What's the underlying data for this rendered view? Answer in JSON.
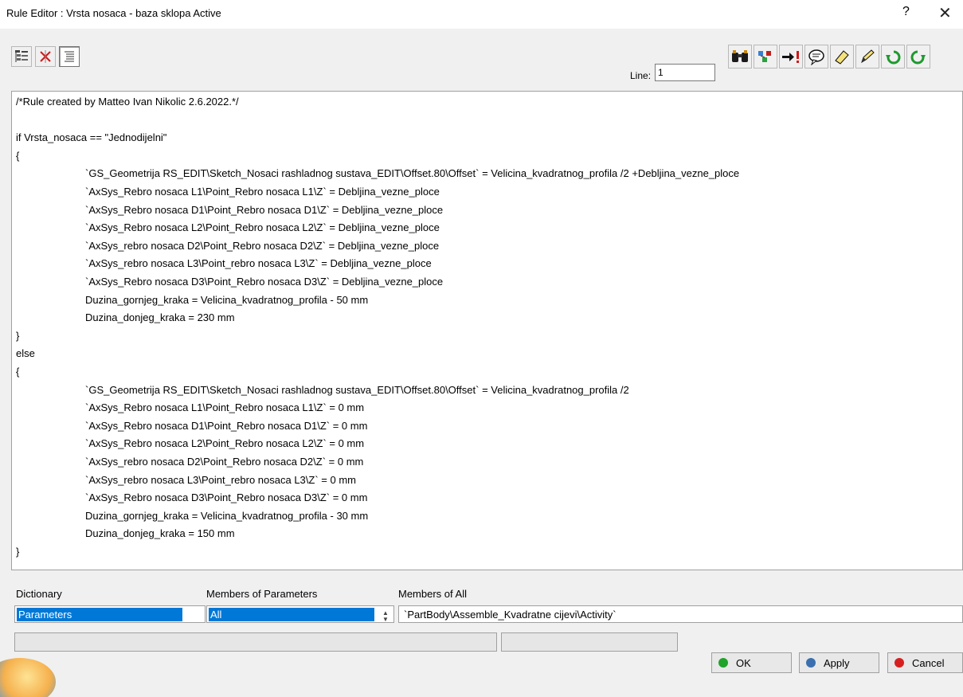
{
  "window": {
    "title": "Rule Editor : Vrsta nosaca - baza sklopa Active",
    "help": "?",
    "close": "✕"
  },
  "toolbar_left": [
    {
      "icon": "tree-view-icon"
    },
    {
      "icon": "cross-out-icon"
    },
    {
      "icon": "text-view-icon"
    }
  ],
  "line": {
    "label": "Line:",
    "value": "1"
  },
  "toolbar_right": [
    {
      "icon": "binoculars-search-icon"
    },
    {
      "icon": "object-browser-icon"
    },
    {
      "icon": "go-to-error-icon"
    },
    {
      "icon": "comment-icon"
    },
    {
      "icon": "eraser-icon"
    },
    {
      "icon": "pencil-icon"
    },
    {
      "icon": "undo-icon"
    },
    {
      "icon": "redo-icon"
    }
  ],
  "editor": {
    "lines": [
      {
        "text": "/*Rule created by Matteo Ivan Nikolic 2.6.2022.*/",
        "indent": false
      },
      {
        "text": "",
        "indent": false
      },
      {
        "text": "if Vrsta_nosaca == \"Jednodijelni\"",
        "indent": false
      },
      {
        "text": "{",
        "indent": false
      },
      {
        "text": "`GS_Geometrija RS_EDIT\\Sketch_Nosaci rashladnog sustava_EDIT\\Offset.80\\Offset` = Velicina_kvadratnog_profila /2 +Debljina_vezne_ploce",
        "indent": true
      },
      {
        "text": "`AxSys_Rebro nosaca L1\\Point_Rebro nosaca L1\\Z` = Debljina_vezne_ploce",
        "indent": true
      },
      {
        "text": "`AxSys_Rebro nosaca D1\\Point_Rebro nosaca D1\\Z` = Debljina_vezne_ploce",
        "indent": true
      },
      {
        "text": "`AxSys_Rebro nosaca L2\\Point_Rebro nosaca L2\\Z` = Debljina_vezne_ploce",
        "indent": true
      },
      {
        "text": "`AxSys_rebro nosaca D2\\Point_Rebro nosaca D2\\Z` = Debljina_vezne_ploce",
        "indent": true
      },
      {
        "text": "`AxSys_rebro nosaca L3\\Point_rebro nosaca L3\\Z` = Debljina_vezne_ploce",
        "indent": true
      },
      {
        "text": "`AxSys_Rebro nosaca D3\\Point_Rebro nosaca D3\\Z` = Debljina_vezne_ploce",
        "indent": true
      },
      {
        "text": "Duzina_gornjeg_kraka = Velicina_kvadratnog_profila - 50 mm",
        "indent": true
      },
      {
        "text": "Duzina_donjeg_kraka = 230 mm",
        "indent": true
      },
      {
        "text": "}",
        "indent": false
      },
      {
        "text": "else",
        "indent": false
      },
      {
        "text": "{",
        "indent": false
      },
      {
        "text": "`GS_Geometrija RS_EDIT\\Sketch_Nosaci rashladnog sustava_EDIT\\Offset.80\\Offset` = Velicina_kvadratnog_profila /2",
        "indent": true
      },
      {
        "text": "`AxSys_Rebro nosaca L1\\Point_Rebro nosaca L1\\Z` = 0 mm",
        "indent": true
      },
      {
        "text": "`AxSys_Rebro nosaca D1\\Point_Rebro nosaca D1\\Z` = 0 mm",
        "indent": true
      },
      {
        "text": "`AxSys_Rebro nosaca L2\\Point_Rebro nosaca L2\\Z` = 0 mm",
        "indent": true
      },
      {
        "text": "`AxSys_rebro nosaca D2\\Point_Rebro nosaca D2\\Z` = 0 mm",
        "indent": true
      },
      {
        "text": "`AxSys_rebro nosaca L3\\Point_rebro nosaca L3\\Z` = 0 mm",
        "indent": true
      },
      {
        "text": "`AxSys_Rebro nosaca D3\\Point_Rebro nosaca D3\\Z` = 0 mm",
        "indent": true
      },
      {
        "text": "Duzina_gornjeg_kraka = Velicina_kvadratnog_profila - 30 mm",
        "indent": true
      },
      {
        "text": "Duzina_donjeg_kraka = 150 mm",
        "indent": true
      },
      {
        "text": "}",
        "indent": false
      }
    ]
  },
  "browser": {
    "dictionary_label": "Dictionary",
    "dictionary_selected": "Parameters",
    "members_params_label": "Members of Parameters",
    "members_params_selected": "All",
    "members_all_label": "Members of All",
    "members_all_value": "`PartBody\\Assemble_Kvadratne cijevi\\Activity`"
  },
  "buttons": {
    "ok": "OK",
    "apply": "Apply",
    "cancel": "Cancel"
  },
  "colors": {
    "selection": "#0078d7",
    "ok_dot": "#1fa32b",
    "apply_dot": "#3a6fb0",
    "cancel_dot": "#d62020"
  }
}
